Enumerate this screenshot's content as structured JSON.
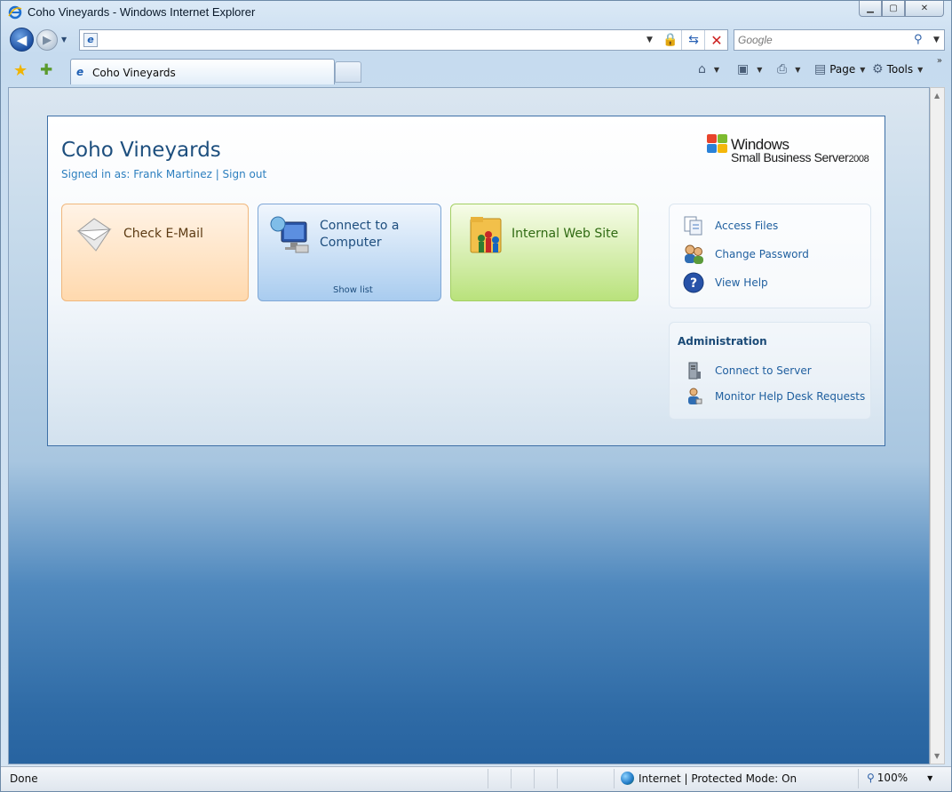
{
  "window": {
    "title": "Coho Vineyards - Windows Internet Explorer"
  },
  "navbar": {
    "address_value": "",
    "search_placeholder": "Google"
  },
  "tabs": {
    "active_label": "Coho Vineyards"
  },
  "commands": {
    "page_label": "Page",
    "tools_label": "Tools"
  },
  "page": {
    "site_title": "Coho Vineyards",
    "signed_prefix": "Signed in as: ",
    "user_name": "Frank Martinez",
    "separator": " | ",
    "sign_out": "Sign out",
    "logo_windows": "Windows",
    "logo_product": "Small Business Server",
    "logo_year": "2008"
  },
  "tiles": {
    "email": "Check E-Mail",
    "connect": "Connect to a Computer",
    "show_list": "Show list",
    "web": "Internal Web Site"
  },
  "side": {
    "items": [
      "Access Files",
      "Change Password",
      "View Help"
    ],
    "admin_title": "Administration",
    "admin_items": [
      "Connect to Server",
      "Monitor Help Desk Requests"
    ]
  },
  "status": {
    "left_text": "Done",
    "zone_text": "Internet | Protected Mode: On",
    "zoom_text": "100%"
  },
  "colors": {
    "accent": "#1d4f7e",
    "link": "#1f5f9f",
    "email_tile": "#ffd9ae",
    "connect_tile": "#a9ccef",
    "web_tile": "#b9e27c"
  }
}
